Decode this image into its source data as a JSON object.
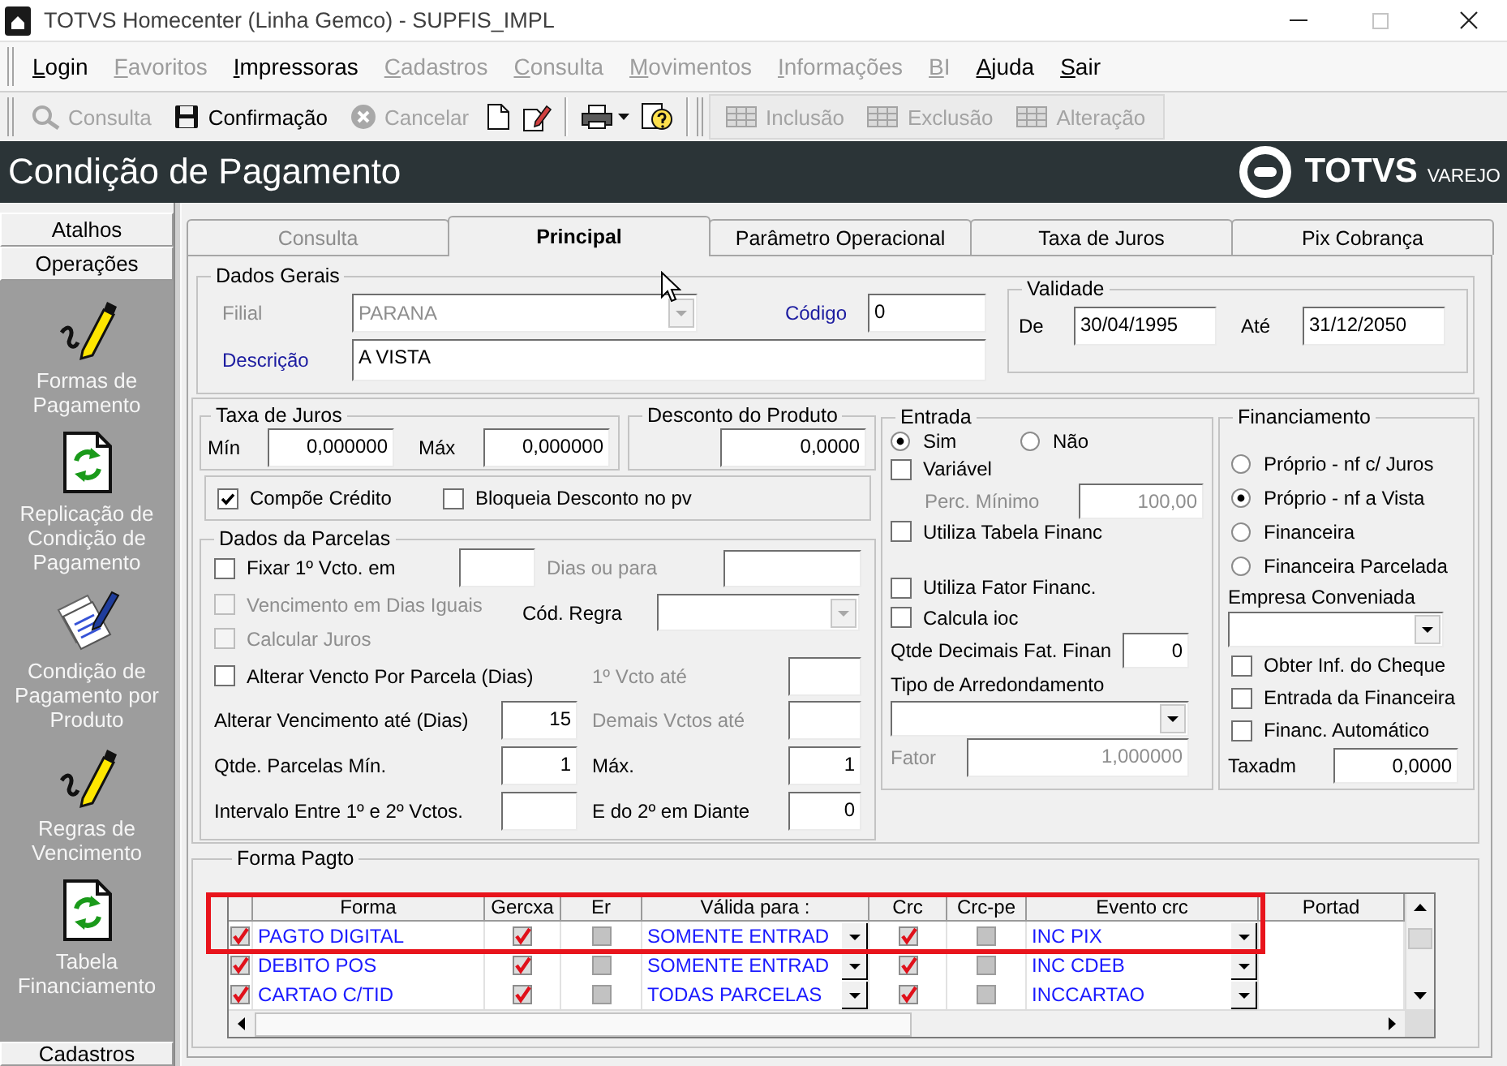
{
  "window": {
    "title": "TOTVS Homecenter (Linha Gemco) - SUPFIS_IMPL"
  },
  "menu": [
    {
      "label": "Login",
      "disabled": false
    },
    {
      "label": "Favoritos",
      "disabled": true
    },
    {
      "label": "Impressoras",
      "disabled": false
    },
    {
      "label": "Cadastros",
      "disabled": true
    },
    {
      "label": "Consulta",
      "disabled": true
    },
    {
      "label": "Movimentos",
      "disabled": true
    },
    {
      "label": "Informações",
      "disabled": true
    },
    {
      "label": "BI",
      "disabled": true
    },
    {
      "label": "Ajuda",
      "disabled": false
    },
    {
      "label": "Sair",
      "disabled": false
    }
  ],
  "toolbar": [
    {
      "label": "Consulta",
      "disabled": true
    },
    {
      "label": "Confirmação",
      "disabled": false
    },
    {
      "label": "Cancelar",
      "disabled": true
    }
  ],
  "record_toolbar": [
    {
      "label": "Inclusão",
      "disabled": true
    },
    {
      "label": "Exclusão",
      "disabled": true
    },
    {
      "label": "Alteração",
      "disabled": true
    }
  ],
  "header": {
    "title": "Condição de Pagamento",
    "brand": "TOTVS",
    "brand_subtitle": "VAREJO"
  },
  "sidebar": {
    "sections": [
      "Atalhos",
      "Operações"
    ],
    "items": [
      "Formas de Pagamento",
      "Replicação de Condição de Pagamento",
      "Condição de Pagamento por Produto",
      "Regras de Vencimento",
      "Tabela Financiamento"
    ],
    "footer": "Cadastros"
  },
  "tabs": [
    {
      "label": "Consulta",
      "selected": false,
      "disabled": true
    },
    {
      "label": "Principal",
      "selected": true,
      "disabled": false
    },
    {
      "label": "Parâmetro Operacional",
      "selected": false,
      "disabled": false
    },
    {
      "label": "Taxa de Juros",
      "selected": false,
      "disabled": false
    },
    {
      "label": "Pix Cobrança",
      "selected": false,
      "disabled": false
    }
  ],
  "dados_gerais": {
    "title": "Dados Gerais",
    "filial": {
      "label": "Filial",
      "value": "PARANA",
      "disabled": true
    },
    "codigo": {
      "label": "Código",
      "value": "0",
      "required": true
    },
    "descricao": {
      "label": "Descrição",
      "value": "A VISTA",
      "required": true
    },
    "validade": {
      "title": "Validade",
      "de": {
        "label": "De",
        "value": "30/04/1995"
      },
      "ate": {
        "label": "Até",
        "value": "31/12/2050"
      }
    }
  },
  "taxa_de_juros": {
    "title": "Taxa de Juros",
    "min": {
      "label": "Mín",
      "value": "0,000000"
    },
    "max": {
      "label": "Máx",
      "value": "0,000000"
    }
  },
  "desconto_do_produto": {
    "title": "Desconto do Produto",
    "value": "0,0000"
  },
  "opcoes": [
    {
      "label": "Compõe Crédito",
      "checked": true
    },
    {
      "label": "Bloqueia Desconto no pv",
      "checked": false
    }
  ],
  "parcelas": {
    "title": "Dados da Parcelas",
    "checks": [
      {
        "label": "Fixar 1º Vcto. em",
        "checked": false,
        "disabled": false
      },
      {
        "label": "Vencimento em Dias Iguais",
        "checked": false,
        "disabled": true
      },
      {
        "label": "Calcular Juros",
        "checked": false,
        "disabled": true
      },
      {
        "label": "Alterar Vencto Por Parcela (Dias)",
        "checked": false,
        "disabled": false
      }
    ],
    "dias_ou_para": {
      "label": "Dias ou para",
      "disabled": true
    },
    "cod_regra": {
      "label": "Cód. Regra",
      "disabled": true
    },
    "primeiro_vcto_ate": {
      "label": "1º Vcto até",
      "disabled": true
    },
    "alterar_vencimento": {
      "label": "Alterar Vencimento até (Dias)",
      "value": "15"
    },
    "demais_vctos_ate": {
      "label": "Demais Vctos até",
      "disabled": true
    },
    "parcelas_min": {
      "label": "Qtde. Parcelas Mín.",
      "value": "1"
    },
    "parcelas_max": {
      "label": "Máx.",
      "value": "1",
      "disabled": false
    },
    "intervalo": {
      "label": "Intervalo Entre 1º e 2º Vctos."
    },
    "do_segundo_em_diante": {
      "label": "E do 2º em Diante",
      "value": "0",
      "disabled": false
    }
  },
  "entrada": {
    "title": "Entrada",
    "options": [
      {
        "label": "Sim",
        "selected": true
      },
      {
        "label": "Não",
        "selected": false
      }
    ],
    "variavel": {
      "label": "Variável",
      "checked": false
    },
    "perc_minimo": {
      "label": "Perc. Mínimo",
      "value": "100,00",
      "disabled": true
    },
    "utiliza_tabela": {
      "label": "Utiliza Tabela Financ",
      "checked": false
    },
    "utiliza_fator": {
      "label": "Utiliza Fator Financ.",
      "checked": false
    },
    "calcula_ioc": {
      "label": "Calcula ioc",
      "checked": false
    },
    "qtde_decimais": {
      "label": "Qtde Decimais Fat. Finan",
      "value": "0"
    },
    "tipo_arredondamento": {
      "label": "Tipo de Arredondamento"
    },
    "fator": {
      "label": "Fator",
      "value": "1,000000",
      "disabled": true
    }
  },
  "financiamento": {
    "title": "Financiamento",
    "options": [
      {
        "label": "Próprio - nf c/ Juros",
        "selected": false
      },
      {
        "label": "Próprio - nf a Vista",
        "selected": true
      },
      {
        "label": "Financeira",
        "selected": false
      },
      {
        "label": "Financeira Parcelada",
        "selected": false
      }
    ],
    "empresa_conveniada": {
      "label": "Empresa Conveniada"
    },
    "checks": [
      {
        "label": "Obter Inf. do Cheque",
        "checked": false
      },
      {
        "label": "Entrada da Financeira",
        "checked": false
      },
      {
        "label": "Financ. Automático",
        "checked": false
      }
    ],
    "taxadm": {
      "label": "Taxadm",
      "value": "0,0000"
    }
  },
  "forma_pagto": {
    "title": "Forma Pagto",
    "columns": [
      "Forma",
      "Gercxa",
      "Er",
      "Válida para :",
      "Crc",
      "Crc-pe",
      "Evento crc",
      "Portad"
    ],
    "rows": [
      {
        "checked": true,
        "forma": "PAGTO DIGITAL",
        "gercxa": true,
        "er": false,
        "valida_para": "SOMENTE ENTRAD",
        "crc": true,
        "crc_pe": false,
        "evento_crc": "INC PIX",
        "highlighted": true
      },
      {
        "checked": true,
        "forma": "DEBITO POS",
        "gercxa": true,
        "er": false,
        "valida_para": "SOMENTE ENTRAD",
        "crc": true,
        "crc_pe": false,
        "evento_crc": "INC CDEB",
        "highlighted": false
      },
      {
        "checked": true,
        "forma": "CARTAO C/TID",
        "gercxa": true,
        "er": false,
        "valida_para": "TODAS PARCELAS",
        "crc": true,
        "crc_pe": false,
        "evento_crc": "INCCARTAO",
        "highlighted": false
      }
    ]
  }
}
